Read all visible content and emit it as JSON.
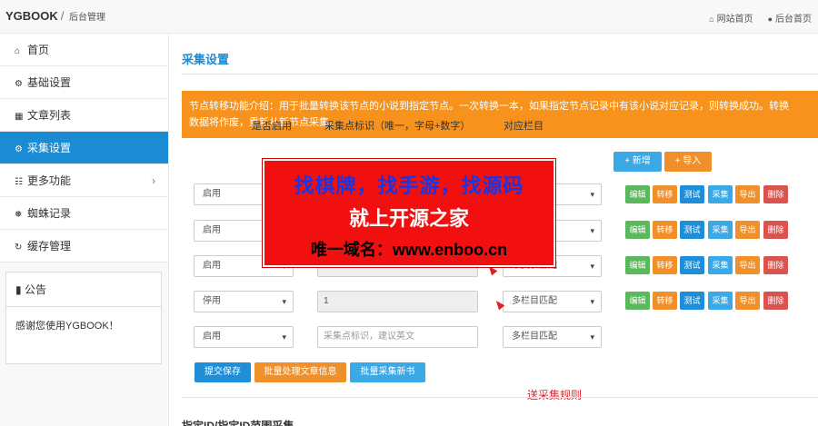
{
  "header": {
    "brand": "YGBOOK",
    "slash": "/",
    "subtitle": "后台管理",
    "links": [
      {
        "icon": "home-icon",
        "label": "网站首页"
      },
      {
        "icon": "user-icon",
        "label": "后台首页"
      }
    ]
  },
  "sidebar": {
    "items": [
      {
        "icon": "home-icon",
        "label": "首页"
      },
      {
        "icon": "gear-icon",
        "label": "基础设置"
      },
      {
        "icon": "table-icon",
        "label": "文章列表"
      },
      {
        "icon": "gears-icon",
        "label": "采集设置",
        "active": true
      },
      {
        "icon": "sitemap-icon",
        "label": "更多功能",
        "chevron": "›"
      },
      {
        "icon": "bug-icon",
        "label": "蜘蛛记录"
      },
      {
        "icon": "refresh-icon",
        "label": "缓存管理"
      }
    ],
    "notice": {
      "title": "公告",
      "text": "感谢您使用YGBOOK！"
    }
  },
  "main": {
    "title": "采集设置",
    "alert_line1": "节点转移功能介绍：用于批量转换该节点的小说到指定节点。一次转换一本，如果指定节点记录中有该小说对应记录，则转换成功。转换",
    "alert_line2": "数据将作废，重新从新节点采集。",
    "col_enable": "是否启用",
    "col_node": "采集点标识（唯一，字母+数字）",
    "col_target": "对应栏目",
    "add_button": "+ 新增",
    "import_button": "+ 导入",
    "rows": [
      {
        "enable": "启用",
        "node": "",
        "target": ""
      },
      {
        "enable": "启用",
        "node": "",
        "target": ""
      },
      {
        "enable": "启用",
        "node": "3",
        "target": "单页表匹配"
      },
      {
        "enable": "停用",
        "node": "1",
        "target": "多栏目匹配"
      },
      {
        "enable": "启用",
        "node_placeholder": "采集点标识，建议英文",
        "target": "多栏目匹配"
      }
    ],
    "row_actions": [
      "编辑",
      "转移",
      "测试",
      "采集",
      "导出",
      "删除"
    ],
    "submit_button": "提交保存",
    "batch_process_button": "批量处理文章信息",
    "batch_collect_button": "批量采集新书",
    "rule_note": "送采集规则",
    "bottom_title": "指定ID/指定ID范围采集"
  },
  "overlay": {
    "line1": "找棋牌，找手游，找源码",
    "line2": "就上开源之家",
    "line3": "唯一域名：www.enboo.cn"
  },
  "colors": {
    "primary": "#1b8bd3",
    "alert": "#f7931d",
    "success": "#5cb85c",
    "danger": "#d9534f",
    "overlay_bg": "#f20f0f"
  }
}
